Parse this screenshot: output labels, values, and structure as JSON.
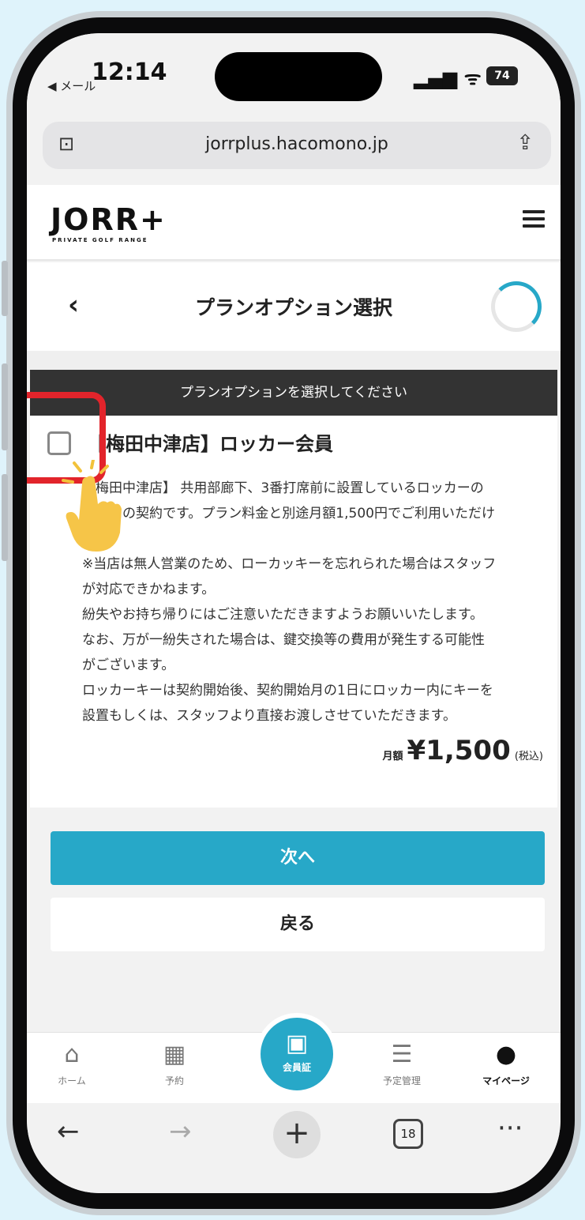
{
  "status_bar": {
    "time": "12:14",
    "back_app": "◀ メール",
    "signal": "▂▄▆ ᯤ",
    "battery": "74"
  },
  "browser": {
    "url": "jorrplus.hacomono.jp"
  },
  "site": {
    "logo": "JORR+",
    "logo_sub": "PRIVATE GOLF RANGE"
  },
  "page": {
    "title": "プランオプション選択"
  },
  "instruction": "プランオプションを選択してください",
  "option": {
    "title": "【梅田中津店】ロッカー会員",
    "description": [
      "【梅田中津店】 共用部廊下、3番打席前に設置しているロッカーの",
      "ご利用の契約です。プラン料金と別途月額1,500円でご利用いただけ",
      "ます。",
      "※当店は無人営業のため、ローカッキーを忘れられた場合はスタッフ",
      "が対応できかねます。",
      "紛失やお持ち帰りにはご注意いただきますようお願いいたします。",
      "なお、万が一紛失された場合は、鍵交換等の費用が発生する可能性",
      "がございます。",
      "ロッカーキーは契約開始後、契約開始月の1日にロッカー内にキーを",
      "設置もしくは、スタッフより直接お渡しさせていただきます。"
    ],
    "price_prefix": "月額",
    "price": "¥1,500",
    "price_tax": "(税込)"
  },
  "buttons": {
    "next": "次へ",
    "back": "戻る"
  },
  "app_nav": {
    "items": [
      {
        "label": "ホーム",
        "icon": "home-icon"
      },
      {
        "label": "予約",
        "icon": "calendar-icon"
      },
      {
        "label": "会員証",
        "icon": "qr-code-icon"
      },
      {
        "label": "予定管理",
        "icon": "list-icon"
      },
      {
        "label": "マイページ",
        "icon": "user-icon"
      }
    ]
  },
  "safari": {
    "tab_count": "18"
  },
  "colors": {
    "accent": "#27a8c8",
    "highlight": "#e2242b",
    "instruction_bg": "#333333"
  }
}
